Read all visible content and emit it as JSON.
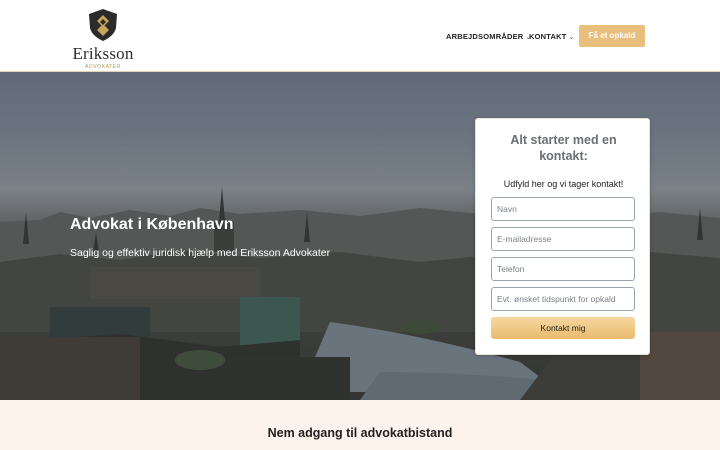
{
  "header": {
    "logo": {
      "name": "Eriksson",
      "tagline": "ADVOKATER"
    },
    "nav": [
      {
        "label": "ARBEJDSOMRÅDER",
        "icon": "chevron-down-icon"
      },
      {
        "label": "KONTAKT",
        "icon": "chevron-down-icon"
      }
    ],
    "cta_label": "Få et opkald"
  },
  "hero": {
    "title": "Advokat i København",
    "subtitle": "Saglig og effektiv juridisk hjælp med Eriksson Advokater"
  },
  "form": {
    "title": "Alt starter med en kontakt:",
    "subtitle": "Udfyld her og vi tager kontakt!",
    "fields": [
      {
        "placeholder": "Navn",
        "value": ""
      },
      {
        "placeholder": "E-mailadresse",
        "value": ""
      },
      {
        "placeholder": "Telefon",
        "value": ""
      },
      {
        "placeholder": "Evt. ønsket tidspunkt for opkald",
        "value": ""
      }
    ],
    "submit_label": "Kontakt mig"
  },
  "section": {
    "title": "Nem adgang til advokatbistand"
  },
  "colors": {
    "accent": "#e9bf7e",
    "logo_gold": "#b9975b",
    "band_bg": "#fbf3ec"
  }
}
